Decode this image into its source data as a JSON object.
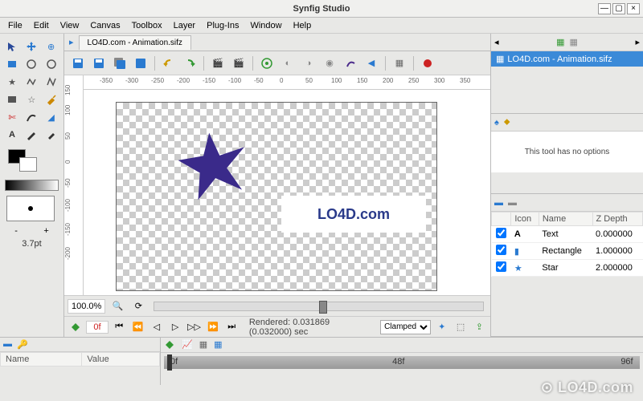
{
  "app_title": "Synfig Studio",
  "menu": [
    "File",
    "Edit",
    "View",
    "Canvas",
    "Toolbox",
    "Layer",
    "Plug-Ins",
    "Window",
    "Help"
  ],
  "document": {
    "name": "LO4D.com - Animation.sifz"
  },
  "brush": {
    "size_label": "3.7pt",
    "minus": "-",
    "plus": "+"
  },
  "ruler_h": [
    "-350",
    "-300",
    "-250",
    "-200",
    "-150",
    "-100",
    "-50",
    "0",
    "50",
    "100",
    "150",
    "200",
    "250",
    "300",
    "350"
  ],
  "ruler_v": [
    "-200",
    "-150",
    "-100",
    "-50",
    "0",
    "50",
    "100",
    "150"
  ],
  "canvas_text": "LO4D.com",
  "status": {
    "zoom": "100.0%",
    "frame": "0f",
    "rendered": "Rendered: 0.031869 (0.032000) sec",
    "lock": "Clamped"
  },
  "right": {
    "doclist": [
      "LO4D.com - Animation.sifz"
    ],
    "optmsg": "This tool has no options",
    "layer_cols": [
      "",
      "Icon",
      "Name",
      "Z Depth"
    ],
    "layers": [
      {
        "on": true,
        "icon": "A",
        "name": "Text",
        "z": "0.000000"
      },
      {
        "on": true,
        "icon": "▮",
        "name": "Rectangle",
        "z": "1.000000"
      },
      {
        "on": true,
        "icon": "★",
        "name": "Star",
        "z": "2.000000"
      }
    ]
  },
  "params_cols": [
    "Name",
    "Value"
  ],
  "timeline_ticks": [
    "0f",
    "48f",
    "96f"
  ],
  "watermark": "⊙ LO4D.com",
  "chart_data": null
}
